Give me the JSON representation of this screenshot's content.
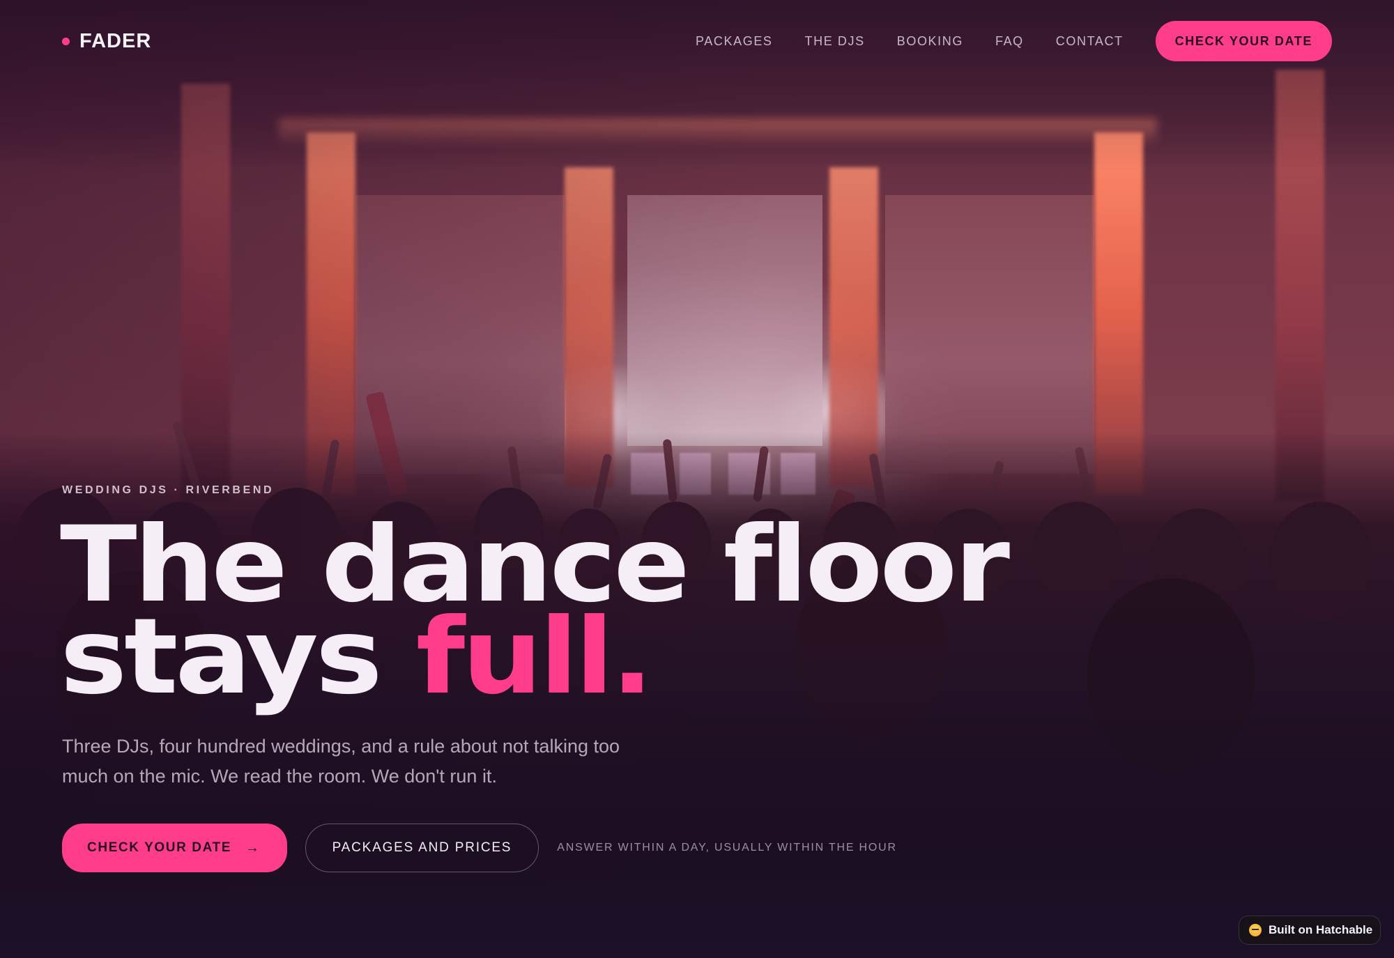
{
  "brand": {
    "name": "FADER",
    "accent_color": "#ff3d8b"
  },
  "nav": {
    "items": [
      "PACKAGES",
      "THE DJS",
      "BOOKING",
      "FAQ",
      "CONTACT"
    ],
    "cta_label": "CHECK YOUR DATE"
  },
  "hero": {
    "eyebrow": "WEDDING DJS · RIVERBEND",
    "headline_line1": "The dance floor",
    "headline_line2_start": "stays ",
    "headline_line2_accent": "full.",
    "subtitle_line1": "Three DJs, four hundred weddings, and a rule about not talking too",
    "subtitle_line2": "much on the mic. We read the room. We don't run it.",
    "primary_cta": "CHECK YOUR DATE",
    "primary_cta_icon": "arrow-right-icon",
    "secondary_cta": "PACKAGES AND PRICES",
    "note": "ANSWER WITHIN A DAY, USUALLY WITHIN THE HOUR",
    "background_image": "wedding-reception-crowd-photo"
  },
  "badge": {
    "label": "Built on Hatchable",
    "icon": "hatchable-icon"
  }
}
